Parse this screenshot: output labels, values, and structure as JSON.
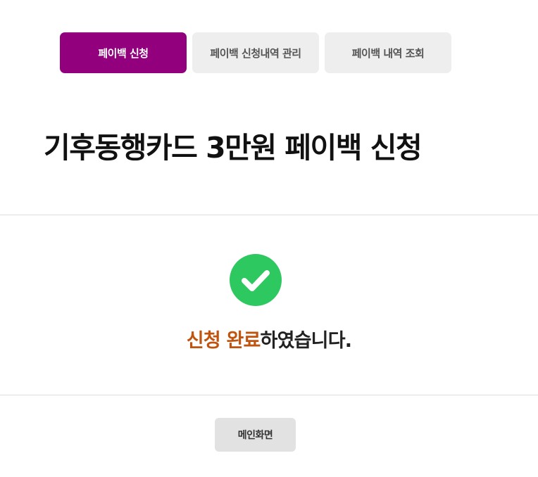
{
  "tabs": [
    {
      "label": "페이백 신청",
      "active": true
    },
    {
      "label": "페이백 신청내역 관리",
      "active": false
    },
    {
      "label": "페이백 내역 조회",
      "active": false
    }
  ],
  "page": {
    "title": "기후동행카드 3만원 페이백 신청"
  },
  "result": {
    "icon": "check-circle-icon",
    "highlight": "신청 완료",
    "suffix": "하였습니다."
  },
  "actions": {
    "main_label": "메인화면"
  },
  "colors": {
    "accent": "#93007e",
    "success": "#2ec860",
    "highlight": "#c0530d"
  }
}
